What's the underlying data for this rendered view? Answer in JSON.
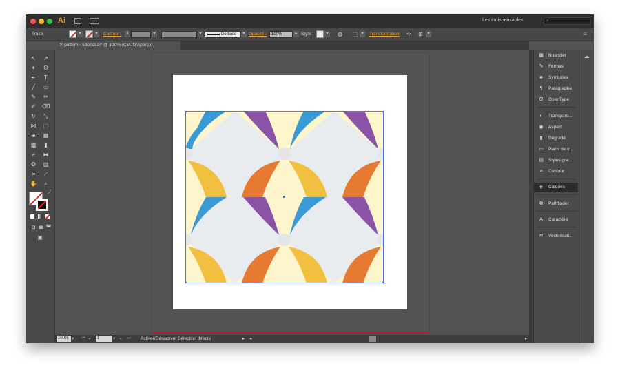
{
  "app": {
    "name": "Ai",
    "workspace": "Les indispensables",
    "search_placeholder": ""
  },
  "control_bar": {
    "object_type": "Tracé",
    "stroke_label": "Contour :",
    "stroke_style": "De base",
    "opacity_label": "Opacité :",
    "opacity_value": "100%",
    "style_label": "Style :",
    "transform_label": "Transformation"
  },
  "document_tab": "pattern - tutorial.ai* @ 100% (CMJN/Aperçu)",
  "status_bar": {
    "zoom": "100%",
    "page": "1",
    "hint": "Activer/Désactiver Sélection directe"
  },
  "panels": [
    {
      "label": "Nuancier",
      "icon": "swatches-icon",
      "glyph": "▦"
    },
    {
      "label": "Formes",
      "icon": "brushes-icon",
      "glyph": "✎"
    },
    {
      "label": "Symboles",
      "icon": "symbols-icon",
      "glyph": "♣"
    },
    {
      "label": "Paragraphe",
      "icon": "paragraph-icon",
      "glyph": "¶"
    },
    {
      "label": "OpenType",
      "icon": "opentype-icon",
      "glyph": "O"
    },
    {
      "label": "Transpare...",
      "icon": "transparency-icon",
      "glyph": "◐"
    },
    {
      "label": "Aspect",
      "icon": "appearance-icon",
      "glyph": "◉"
    },
    {
      "label": "Dégradé",
      "icon": "gradient-icon",
      "glyph": "▮"
    },
    {
      "label": "Plans de tr...",
      "icon": "artboards-icon",
      "glyph": "▭"
    },
    {
      "label": "Styles gra...",
      "icon": "graphic-styles-icon",
      "glyph": "▤"
    },
    {
      "label": "Contour",
      "icon": "stroke-icon",
      "glyph": "≡"
    },
    {
      "label": "Calques",
      "icon": "layers-icon",
      "glyph": "◈"
    },
    {
      "label": "Pathfinder",
      "icon": "pathfinder-icon",
      "glyph": "⧉"
    },
    {
      "label": "Caractère",
      "icon": "character-icon",
      "glyph": "A"
    },
    {
      "label": "Vectorisati...",
      "icon": "image-trace-icon",
      "glyph": "✲"
    }
  ],
  "colors": {
    "blue": "#3a9ad6",
    "purple": "#8b53a5",
    "yellow": "#f2c040",
    "orange": "#e67a30",
    "cream": "#fdf5cc",
    "grey": "#e9ecee",
    "accent": "#e8a040"
  }
}
